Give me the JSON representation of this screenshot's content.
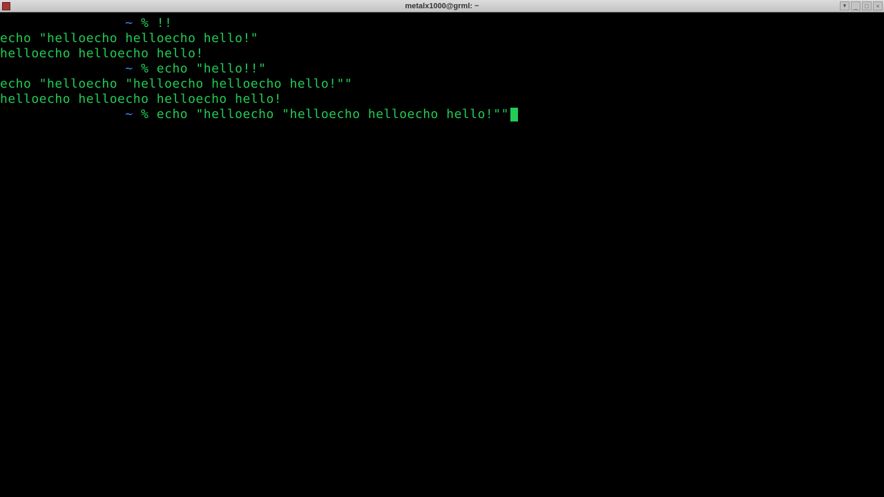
{
  "window": {
    "title": "metalx1000@grml: ~"
  },
  "titlebar_buttons": {
    "b1": "▾",
    "b2": "_",
    "b3": "□",
    "b4": "×"
  },
  "terminal": {
    "prompt_path": "~",
    "prompt_symbol": "%",
    "lines": {
      "l1_cmd": "!!",
      "l2": "echo \"helloecho helloecho hello!\"",
      "l3": "helloecho helloecho hello!",
      "l4_cmd": "echo \"hello!!\"",
      "l5": "echo \"helloecho \"helloecho helloecho hello!\"\"",
      "l6": "helloecho helloecho helloecho hello!",
      "l7_cmd": "echo \"helloecho \"helloecho helloecho hello!\"\""
    }
  }
}
